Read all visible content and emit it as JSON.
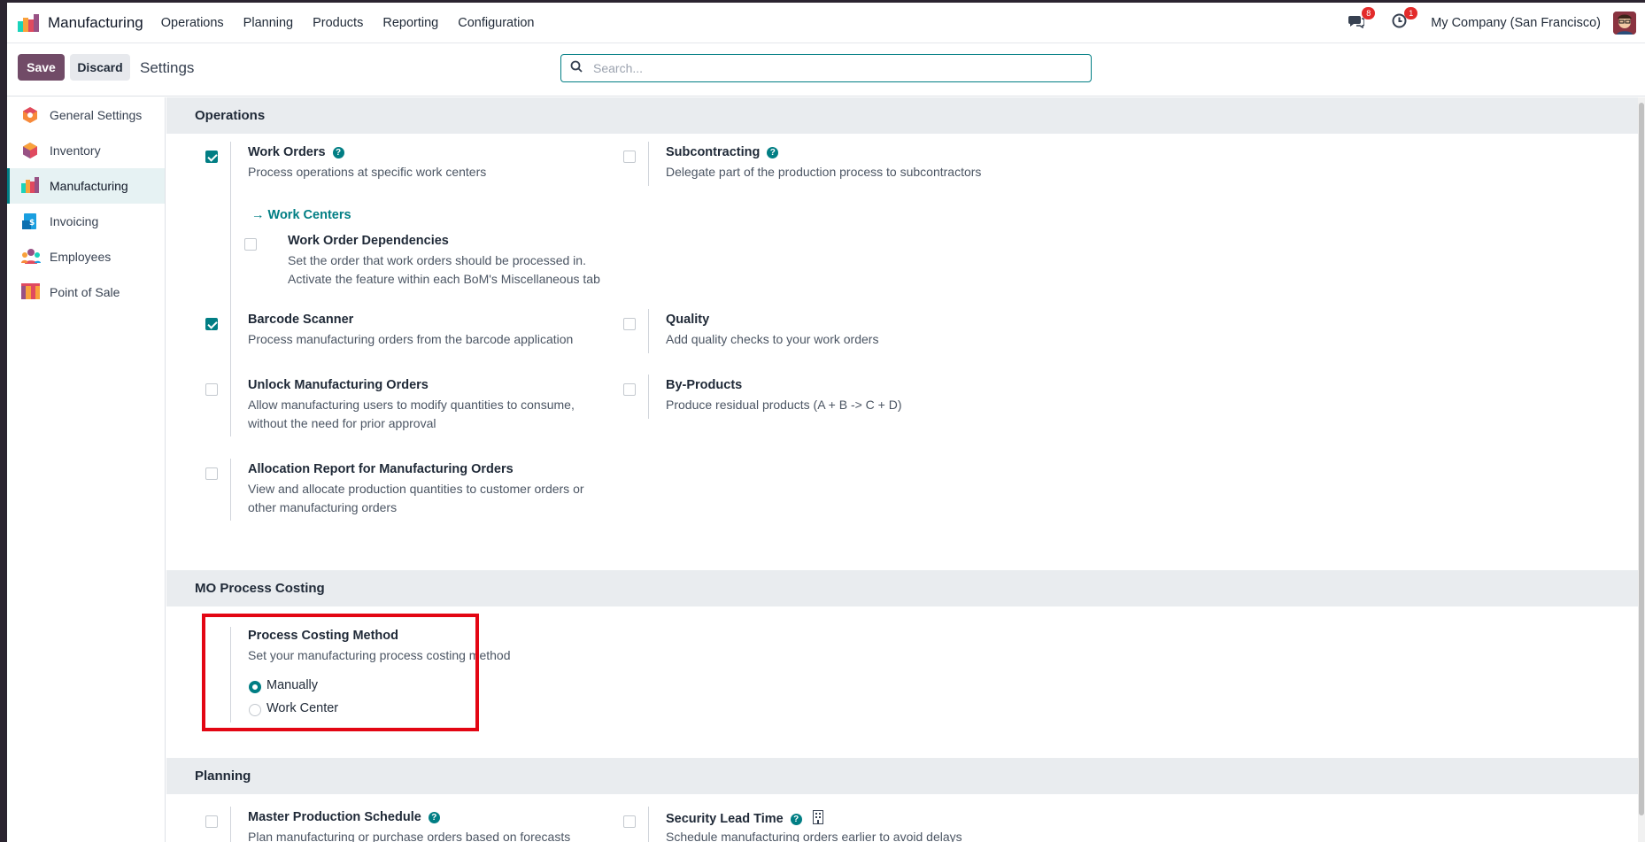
{
  "navbar": {
    "app_name": "Manufacturing",
    "menu": [
      "Operations",
      "Planning",
      "Products",
      "Reporting",
      "Configuration"
    ],
    "messages_badge": "8",
    "activities_badge": "1",
    "company": "My Company (San Francisco)"
  },
  "control": {
    "save_label": "Save",
    "discard_label": "Discard",
    "breadcrumb": "Settings",
    "search_placeholder": "Search..."
  },
  "sidebar": {
    "items": [
      {
        "label": "General Settings",
        "icon": "general-settings-icon"
      },
      {
        "label": "Inventory",
        "icon": "inventory-icon"
      },
      {
        "label": "Manufacturing",
        "icon": "manufacturing-icon",
        "active": true
      },
      {
        "label": "Invoicing",
        "icon": "invoicing-icon"
      },
      {
        "label": "Employees",
        "icon": "employees-icon"
      },
      {
        "label": "Point of Sale",
        "icon": "point-of-sale-icon"
      }
    ]
  },
  "sections": {
    "operations": "Operations",
    "mo_costing": "MO Process Costing",
    "planning": "Planning"
  },
  "settings": {
    "work_orders": {
      "title": "Work Orders",
      "desc": "Process operations at specific work centers",
      "checked": true
    },
    "work_centers_link": "Work Centers",
    "wo_dependencies": {
      "title": "Work Order Dependencies",
      "desc": "Set the order that work orders should be processed in. Activate the feature within each BoM's Miscellaneous tab",
      "checked": false
    },
    "subcontracting": {
      "title": "Subcontracting",
      "desc": "Delegate part of the production process to subcontractors",
      "checked": false
    },
    "barcode": {
      "title": "Barcode Scanner",
      "desc": "Process manufacturing orders from the barcode application",
      "checked": true
    },
    "quality": {
      "title": "Quality",
      "desc": "Add quality checks to your work orders",
      "checked": false
    },
    "unlock_mo": {
      "title": "Unlock Manufacturing Orders",
      "desc": "Allow manufacturing users to modify quantities to consume, without the need for prior approval",
      "checked": false
    },
    "byproducts": {
      "title": "By-Products",
      "desc": "Produce residual products (A + B -> C + D)",
      "checked": false
    },
    "allocation": {
      "title": "Allocation Report for Manufacturing Orders",
      "desc": "View and allocate production quantities to customer orders or other manufacturing orders",
      "checked": false
    },
    "costing_method": {
      "title": "Process Costing Method",
      "desc": "Set your manufacturing process costing method",
      "options": [
        "Manually",
        "Work Center"
      ],
      "selected": "Manually"
    },
    "mps": {
      "title": "Master Production Schedule",
      "desc": "Plan manufacturing or purchase orders based on forecasts",
      "checked": false
    },
    "security_lead": {
      "title": "Security Lead Time",
      "desc": "Schedule manufacturing orders earlier to avoid delays",
      "checked": false
    }
  },
  "colors": {
    "brand": "#714b67",
    "accent": "#017e84",
    "highlight": "#e30613"
  }
}
